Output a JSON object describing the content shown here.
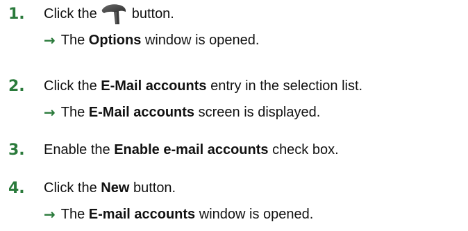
{
  "steps": [
    {
      "number": "1.",
      "before": "Click the",
      "icon": "hammer-icon",
      "after": "button.",
      "result": {
        "before": "The",
        "bold": "Options",
        "after": "window is opened."
      }
    },
    {
      "number": "2.",
      "before": "Click the",
      "bold": "E-Mail accounts",
      "after": "entry in the selection list.",
      "result": {
        "before": "The",
        "bold": "E-Mail accounts",
        "after": "screen is displayed."
      }
    },
    {
      "number": "3.",
      "before": "Enable the",
      "bold": "Enable e-mail accounts",
      "after": "check box."
    },
    {
      "number": "4.",
      "before": "Click the",
      "bold": "New",
      "after": "button.",
      "result": {
        "before": "The",
        "bold": "E-mail accounts",
        "after": "window is opened."
      }
    }
  ],
  "arrow_glyph": "→",
  "colors": {
    "step_number": "#2a7a3b",
    "arrow": "#2a7a3b",
    "text": "#111111"
  }
}
